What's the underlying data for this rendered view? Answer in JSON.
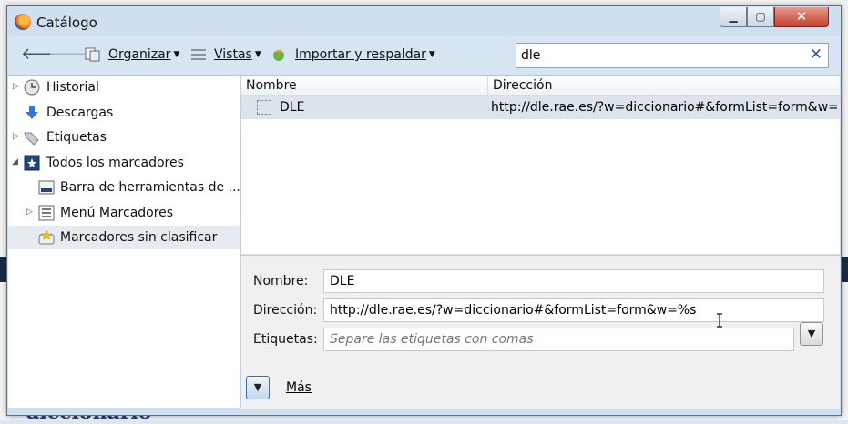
{
  "window": {
    "title": "Catálogo",
    "controls": {
      "minimize": "▁",
      "maximize": "▢",
      "close": "✕"
    }
  },
  "toolbar": {
    "back_icon": "arrow-left-icon",
    "forward_icon": "arrow-right-icon",
    "organize_label": "Organizar",
    "views_label": "Vistas",
    "import_label": "Importar y respaldar",
    "search_value": "dle",
    "clear_icon": "close-icon"
  },
  "sidebar": {
    "items": [
      {
        "label": "Historial",
        "icon": "clock-icon",
        "expandable": true
      },
      {
        "label": "Descargas",
        "icon": "download-arrow-icon",
        "expandable": false
      },
      {
        "label": "Etiquetas",
        "icon": "tag-icon",
        "expandable": true
      },
      {
        "label": "Todos los marcadores",
        "icon": "bookmarks-book-icon",
        "expandable": true,
        "expanded": true
      },
      {
        "label": "Barra de herramientas de ...",
        "icon": "toolbar-bookmark-icon",
        "expandable": false
      },
      {
        "label": "Menú Marcadores",
        "icon": "list-icon",
        "expandable": true
      },
      {
        "label": "Marcadores sin clasificar",
        "icon": "unsorted-star-icon",
        "expandable": false,
        "selected": true
      }
    ]
  },
  "list": {
    "columns": [
      "Nombre",
      "Dirección"
    ],
    "rows": [
      {
        "name": "DLE",
        "url": "http://dle.rae.es/?w=diccionario#&formList=form&w=..."
      }
    ]
  },
  "details": {
    "name_label": "Nombre:",
    "name_value": "DLE",
    "address_label": "Dirección:",
    "address_value": "http://dle.rae.es/?w=diccionario#&formList=form&w=%s",
    "tags_label": "Etiquetas:",
    "tags_placeholder": "Separe las etiquetas con comas",
    "more_label": "Más"
  },
  "background": {
    "partial_text": "diccionario"
  },
  "colors": {
    "selection": "#dde3ea",
    "accent": "#2b5aa8",
    "close_button": "#c5402e"
  }
}
